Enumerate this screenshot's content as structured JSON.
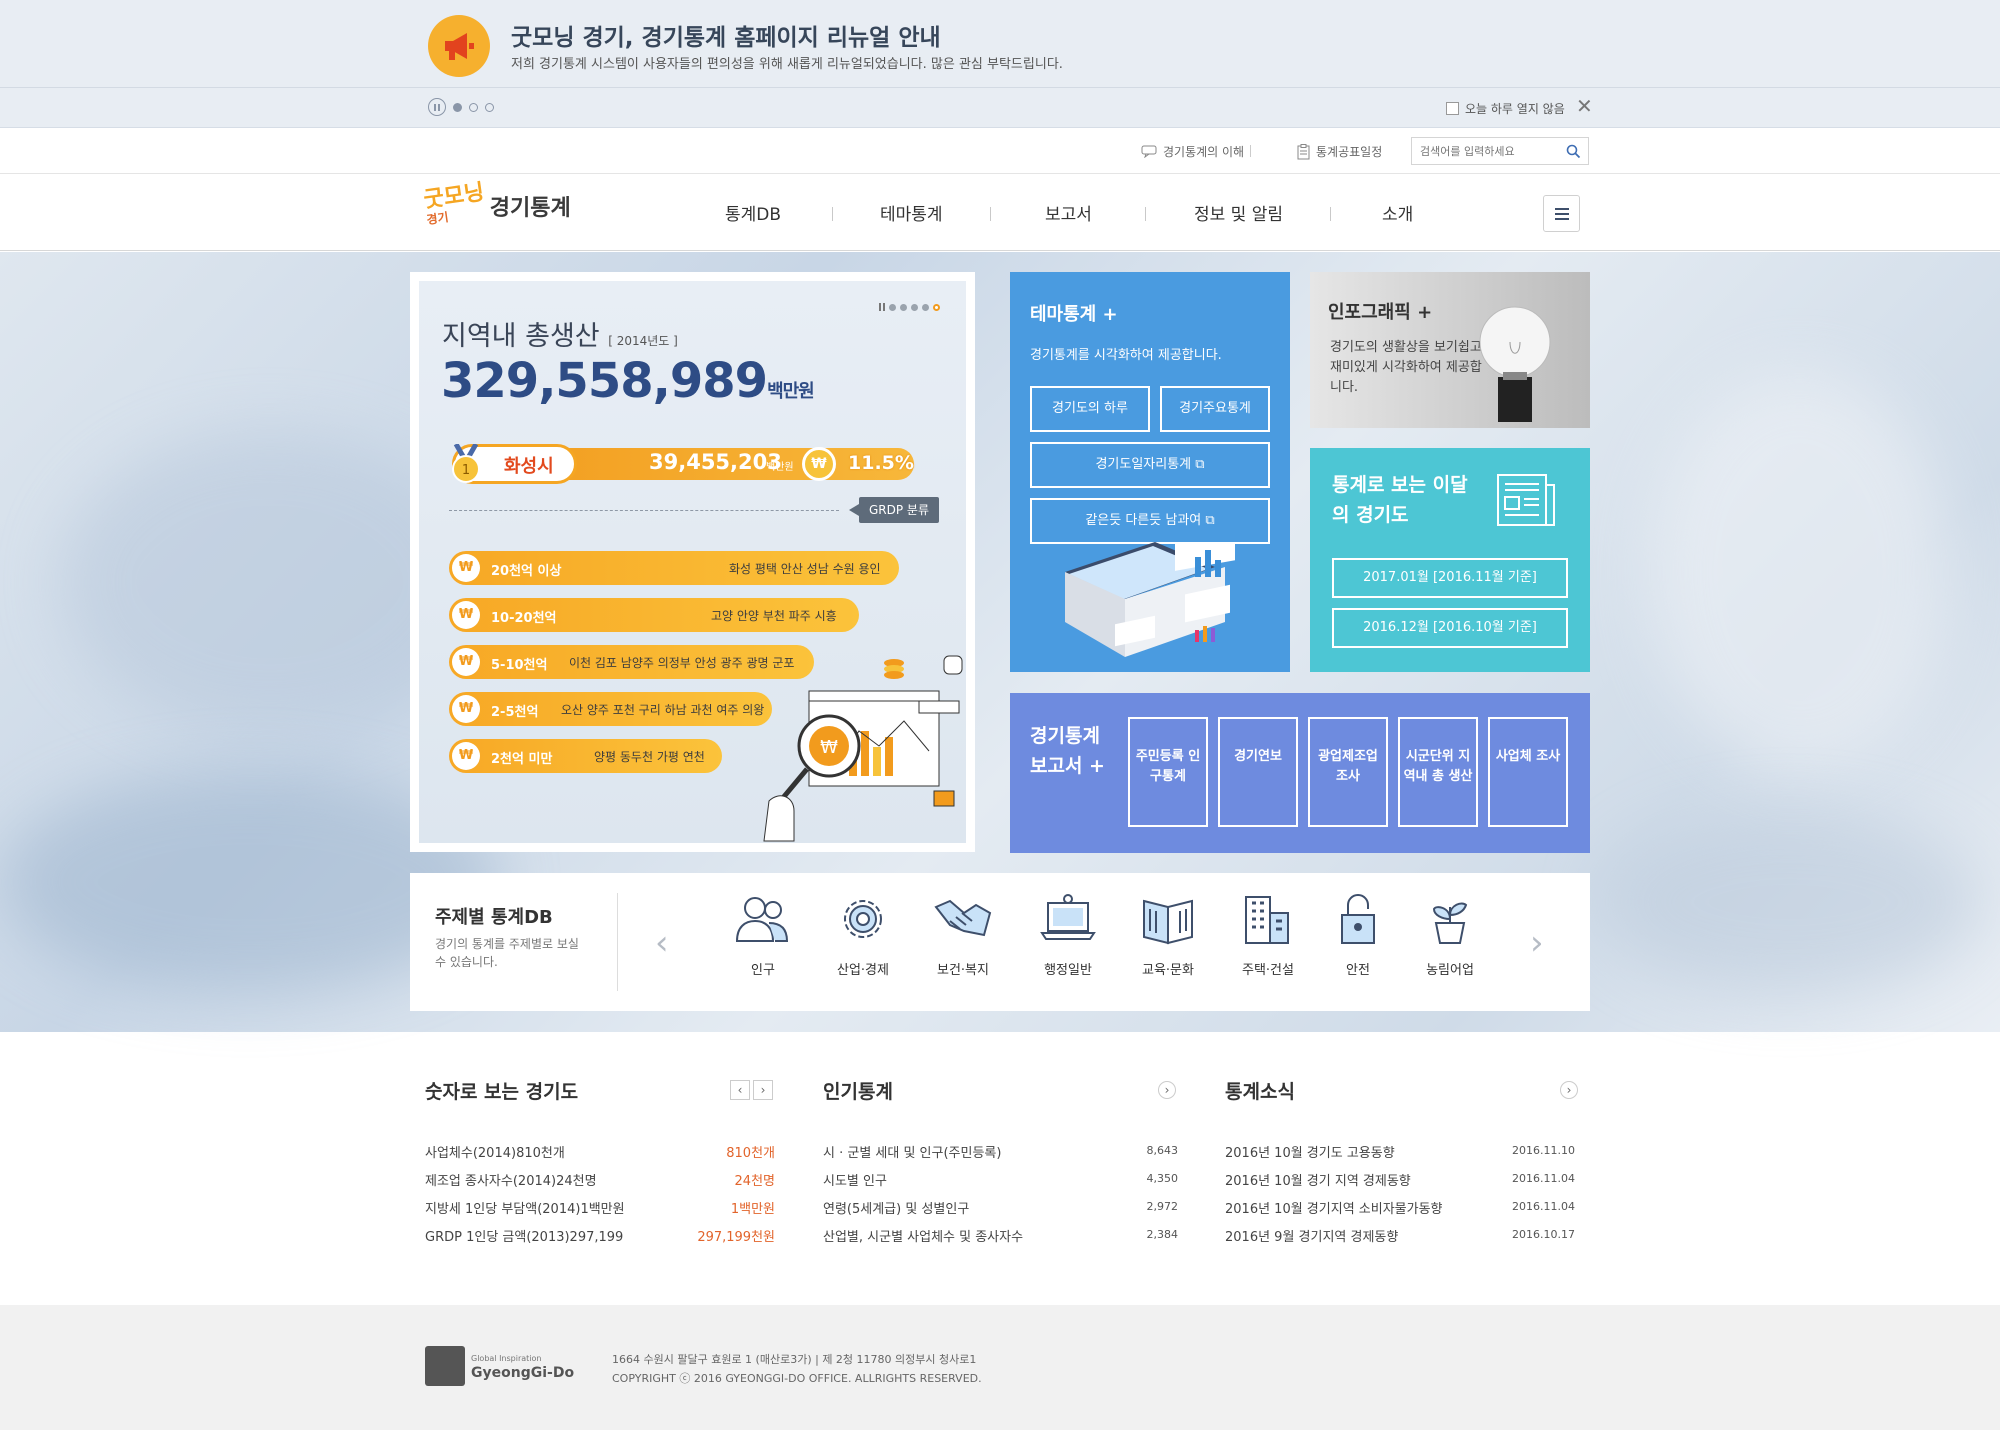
{
  "notice": {
    "title": "굿모닝 경기, 경기통계 홈페이지 리뉴얼 안내",
    "description": "저희 경기통계 시스템이 사용자들의 편의성을 위해 새롭게 리뉴얼되었습니다.  많은 관심 부탁드립니다.",
    "no_today_label": "오늘 하루 열지 않음",
    "close_label": "✕"
  },
  "util": {
    "about_label": "경기통계의 이해",
    "schedule_label": "통계공표일정",
    "search_placeholder": "검색어를 입력하세요"
  },
  "header": {
    "logo_mark_top": "굿모닝",
    "logo_mark_bottom": "경기",
    "logo_text": "경기통계",
    "nav": [
      "통계DB",
      "테마통계",
      "보고서",
      "정보 및 알림",
      "소개"
    ]
  },
  "grdp": {
    "title": "지역내 총생산",
    "year": "[ 2014년도 ]",
    "value": "329,558,989",
    "unit": "백만원",
    "rank1_city": "화성시",
    "rank1_value": "39,455,203",
    "rank1_unit": "백만원",
    "rank1_pct": "11.5%",
    "currency_symbol": "₩",
    "tag": "GRDP 분류",
    "tiers": [
      {
        "label": "20천억 이상",
        "cities": "화성 평택 안산 성남 수원 용인"
      },
      {
        "label": "10-20천억",
        "cities": "고양 안양 부천 파주 시흥"
      },
      {
        "label": "5-10천억",
        "cities": "이천 김포 남양주 의정부 안성 광주 광명 군포"
      },
      {
        "label": "2-5천억",
        "cities": "오산 양주 포천 구리 하남 과천 여주 의왕"
      },
      {
        "label": "2천억 미만",
        "cities": "양평 동두천 가평 연천"
      }
    ]
  },
  "theme": {
    "title": "테마통계 +",
    "description": "경기통계를 시각화하여 제공합니다.",
    "buttons": [
      "경기도의 하루",
      "경기주요통계",
      "경기도일자리통계 ⧉",
      "같은듯 다른듯 남과여 ⧉"
    ]
  },
  "infographic": {
    "title": "인포그래픽 +",
    "description": "경기도의 생활상을 보기쉽고 재미있게 시각화하여 제공합니다."
  },
  "monthly": {
    "title": "통계로 보는 이달의 경기도",
    "items": [
      "2017.01월 [2016.11월 기준]",
      "2016.12월 [2016.10월 기준]"
    ]
  },
  "reports": {
    "title": "경기통계 보고서 +",
    "items": [
      "주민등록 인구통계",
      "경기연보",
      "광업제조업 조사",
      "시군단위 지역내 총 생산",
      "사업체 조사"
    ]
  },
  "subject_db": {
    "title": "주제별 통계DB",
    "description": "경기의 통계를 주제별로 보실 수 있습니다.",
    "prev": "‹",
    "next": "›",
    "items": [
      {
        "label": "인구",
        "icon": "people-icon"
      },
      {
        "label": "산업·경제",
        "icon": "gear-icon"
      },
      {
        "label": "보건·복지",
        "icon": "handshake-icon"
      },
      {
        "label": "행정일반",
        "icon": "laptop-icon"
      },
      {
        "label": "교육·문화",
        "icon": "book-icon"
      },
      {
        "label": "주택·건설",
        "icon": "building-icon"
      },
      {
        "label": "안전",
        "icon": "lock-icon"
      },
      {
        "label": "농림어업",
        "icon": "plant-icon"
      }
    ]
  },
  "numbers": {
    "title": "숫자로 보는 경기도",
    "rows": [
      {
        "text": "사업체수(2014)810천개",
        "value": "810천개"
      },
      {
        "text": "제조업 종사자수(2014)24천명",
        "value": "24천명"
      },
      {
        "text": "지방세 1인당 부담액(2014)1백만원",
        "value": "1백만원"
      },
      {
        "text": "GRDP 1인당 금액(2013)297,199",
        "value": "297,199천원"
      }
    ]
  },
  "popular": {
    "title": "인기통계",
    "rows": [
      {
        "text": "시 · 군별 세대 및 인구(주민등록)",
        "value": "8,643"
      },
      {
        "text": "시도별 인구",
        "value": "4,350"
      },
      {
        "text": "연령(5세계급) 및 성별인구",
        "value": "2,972"
      },
      {
        "text": "산업별, 시군별 사업체수 및 종사자수",
        "value": "2,384"
      }
    ]
  },
  "news": {
    "title": "통계소식",
    "rows": [
      {
        "text": "2016년 10월 경기도 고용동향",
        "value": "2016.11.10"
      },
      {
        "text": "2016년 10월 경기 지역 경제동향",
        "value": "2016.11.04"
      },
      {
        "text": "2016년 10월 경기지역 소비자물가동향",
        "value": "2016.11.04"
      },
      {
        "text": "2016년 9월 경기지역 경제동향",
        "value": "2016.10.17"
      }
    ]
  },
  "footer": {
    "logo_small": "Global Inspiration",
    "logo_text": "GyeongGi-Do",
    "address": "1664 수원시 팔달구 효원로 1 (매산로3가)  |  제 2청 11780 의정부시 청사로1",
    "copyright": "COPYRIGHT ⓒ 2016 GYEONGGI-DO OFFICE. ALLRIGHTS RESERVED."
  },
  "colors": {
    "theme_blue": "#4a9be0",
    "monthly_teal": "#4dc6d4",
    "reports_purple": "#6e8bdf",
    "accent_orange": "#f5a623",
    "highlight_red": "#e2642b"
  }
}
